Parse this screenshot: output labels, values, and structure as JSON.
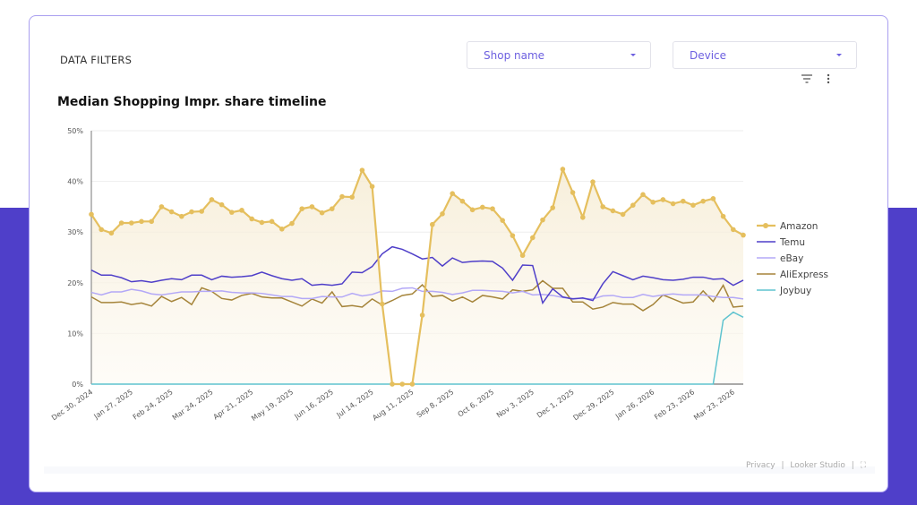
{
  "filters": {
    "label": "DATA FILTERS",
    "shop_name": "Shop name",
    "device": "Device"
  },
  "footer": {
    "privacy": "Privacy",
    "separator": "|",
    "looker": "Looker Studio"
  },
  "colors": {
    "accent": "#4f3fc9"
  },
  "chart_data": {
    "type": "line",
    "title": "Median Shopping Impr. share timeline",
    "xlabel": "",
    "ylabel": "",
    "ylim": [
      0,
      50
    ],
    "y_ticks": [
      "0%",
      "10%",
      "20%",
      "30%",
      "40%",
      "50%"
    ],
    "x_tick_labels": [
      "Dec 30, 2024",
      "Jan 27, 2025",
      "Feb 24, 2025",
      "Mar 24, 2025",
      "Apr 21, 2025",
      "May 19, 2025",
      "Jun 16, 2025",
      "Jul 14, 2025",
      "Aug 11, 2025",
      "Sep 8, 2025",
      "Oct 6, 2025",
      "Nov 3, 2025",
      "Dec 1, 2025",
      "Dec 29, 2025",
      "Jan 26, 2026",
      "Feb 23, 2026",
      "Mar 23, 2026"
    ],
    "x_interval": "weekly",
    "grid": true,
    "legend": "right",
    "series": [
      {
        "name": "Amazon",
        "color": "#e5bf5e",
        "area": true,
        "markers": true,
        "values": [
          33.5,
          30.5,
          29.8,
          31.8,
          31.8,
          32.1,
          32.1,
          35,
          34,
          33.1,
          34,
          34.1,
          36.4,
          35.4,
          33.9,
          34.3,
          32.6,
          31.9,
          32.1,
          30.6,
          31.7,
          34.6,
          35,
          33.8,
          34.6,
          37,
          36.9,
          42.2,
          39,
          15.8,
          0,
          0,
          0,
          13.6,
          31.5,
          33.6,
          37.6,
          36.1,
          34.4,
          34.9,
          34.6,
          32.3,
          29.3,
          25.4,
          28.9,
          32.4,
          34.8,
          42.4,
          37.8,
          32.9,
          39.9,
          35,
          34.2,
          33.5,
          35.3,
          37.4,
          35.9,
          36.4,
          35.6,
          36.1,
          35.3,
          36.1,
          36.6,
          33.1,
          30.5,
          29.4
        ]
      },
      {
        "name": "Temu",
        "color": "#4f3fc9",
        "values": [
          22.5,
          21.5,
          21.5,
          21,
          20.2,
          20.4,
          20.1,
          20.5,
          20.8,
          20.6,
          21.5,
          21.5,
          20.6,
          21.3,
          21.1,
          21.2,
          21.4,
          22.1,
          21.4,
          20.8,
          20.5,
          20.8,
          19.5,
          19.7,
          19.5,
          19.8,
          22.1,
          22,
          23.2,
          25.7,
          27.1,
          26.6,
          25.7,
          24.7,
          25,
          23.3,
          24.9,
          24,
          24.2,
          24.3,
          24.2,
          22.9,
          20.5,
          23.5,
          23.4,
          16,
          18.8,
          17.2,
          16.8,
          17,
          16.5,
          19.8,
          22.2,
          21.4,
          20.6,
          21.3,
          21,
          20.6,
          20.5,
          20.7,
          21.1,
          21.1,
          20.7,
          20.8,
          19.5,
          20.5
        ]
      },
      {
        "name": "eBay",
        "color": "#b3a8f7",
        "values": [
          18.1,
          17.6,
          18.2,
          18.2,
          18.7,
          18.4,
          17.8,
          17.6,
          17.9,
          18.2,
          18.2,
          18.3,
          18.3,
          18.4,
          18.1,
          18,
          18,
          17.9,
          17.6,
          17.3,
          17.3,
          16.9,
          16.9,
          17.3,
          17.2,
          17.2,
          17.9,
          17.4,
          17.7,
          18.4,
          18.3,
          18.9,
          19,
          18.3,
          18.3,
          18.1,
          17.7,
          18,
          18.5,
          18.5,
          18.4,
          18.3,
          18,
          18.3,
          17.6,
          17.7,
          17.5,
          17.1,
          16.9,
          16.9,
          16.8,
          17.4,
          17.5,
          17.1,
          17.1,
          17.7,
          17.3,
          17.6,
          17.8,
          17.6,
          17.6,
          17.6,
          17.3,
          17.1,
          17.1,
          16.8
        ]
      },
      {
        "name": "AliExpress",
        "color": "#a5843a",
        "values": [
          17.2,
          16.1,
          16.1,
          16.2,
          15.7,
          16,
          15.4,
          17.3,
          16.3,
          17.1,
          15.7,
          19,
          18.3,
          16.9,
          16.6,
          17.5,
          17.9,
          17.2,
          17,
          17,
          16.2,
          15.4,
          16.8,
          16,
          18.2,
          15.3,
          15.5,
          15.2,
          16.8,
          15.6,
          16.5,
          17.5,
          17.8,
          19.6,
          17.3,
          17.5,
          16.4,
          17.2,
          16.2,
          17.5,
          17.2,
          16.8,
          18.6,
          18.3,
          18.6,
          20.4,
          18.9,
          18.9,
          16.2,
          16.2,
          14.8,
          15.2,
          16.1,
          15.8,
          15.8,
          14.5,
          15.7,
          17.6,
          16.8,
          16,
          16.2,
          18.4,
          16.3,
          19.5,
          15.2,
          15.4
        ]
      },
      {
        "name": "Joybuy",
        "color": "#5fc3cf",
        "values": [
          0,
          0,
          0,
          0,
          0,
          0,
          0,
          0,
          0,
          0,
          0,
          0,
          0,
          0,
          0,
          0,
          0,
          0,
          0,
          0,
          0,
          0,
          0,
          0,
          0,
          0,
          0,
          0,
          0,
          0,
          0,
          0,
          0,
          0,
          0,
          0,
          0,
          0,
          0,
          0,
          0,
          0,
          0,
          0,
          0,
          0,
          0,
          0,
          0,
          0,
          0,
          0,
          0,
          0,
          0,
          0,
          0,
          0,
          0,
          0,
          0,
          0,
          0,
          12.6,
          14.2,
          13.2
        ]
      }
    ]
  }
}
